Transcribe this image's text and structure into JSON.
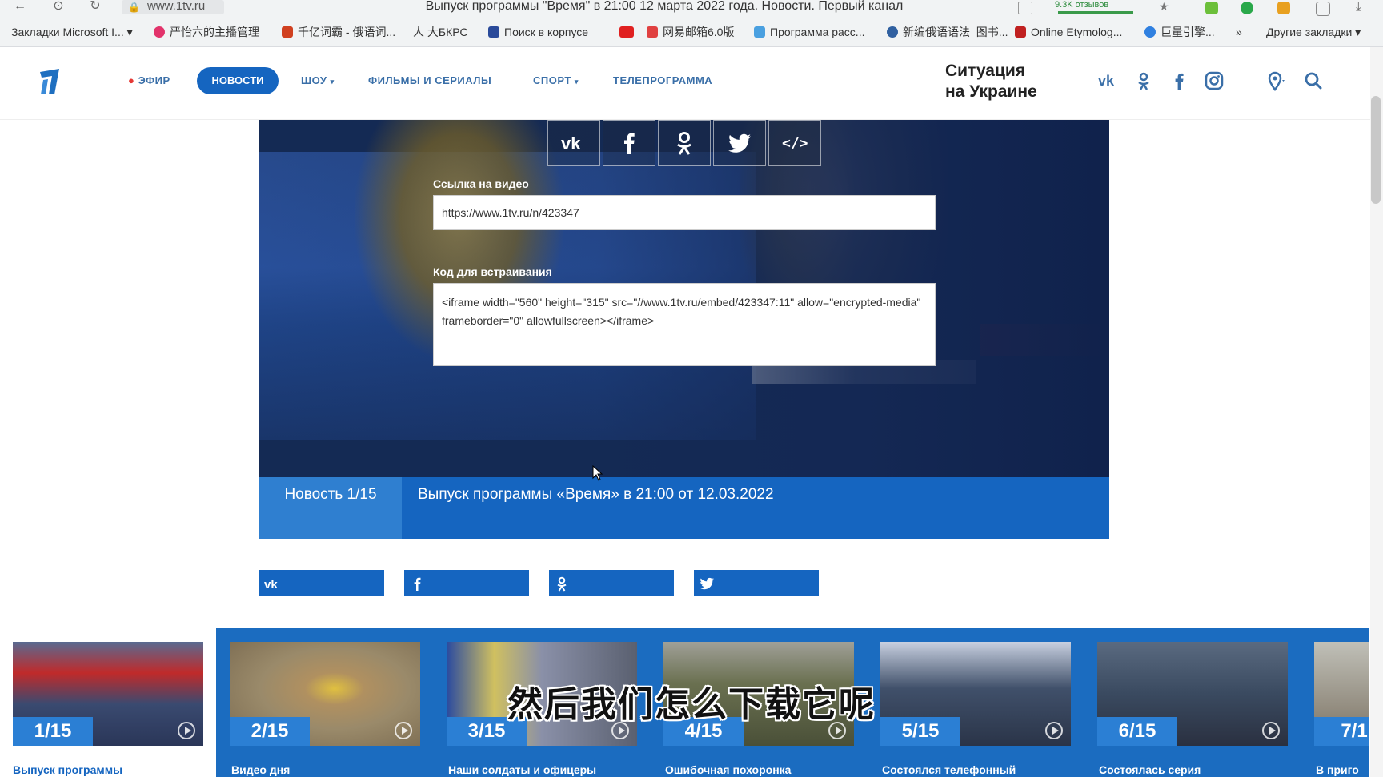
{
  "browser": {
    "url": "www.1tv.ru",
    "title": "Выпуск программы \"Время\" в 21:00 12 марта 2022 года. Новости. Первый канал",
    "review_badge": "9.3K отзывов",
    "bookmarks": [
      {
        "label": "Закладки Microsoft I...",
        "color": "#3a7bd5"
      },
      {
        "label": "严怡六的主播管理",
        "color": "#e2336b"
      },
      {
        "label": "千亿词霸 - 俄语词...",
        "color": "#d04020"
      },
      {
        "label": "大БКРС",
        "color": "#555555"
      },
      {
        "label": "Поиск в корпусе",
        "color": "#2a4a9a"
      },
      {
        "label": "",
        "color": "#e02020"
      },
      {
        "label": "网易邮箱6.0版",
        "color": "#e04040"
      },
      {
        "label": "Программа расс...",
        "color": "#4aa0e0"
      },
      {
        "label": "新编俄语语法_图书...",
        "color": "#3060a0"
      },
      {
        "label": "Online Etymolog...",
        "color": "#c02020"
      },
      {
        "label": "巨量引擎...",
        "color": "#3080e0"
      }
    ],
    "more_bookmarks": "»",
    "other_bookmarks": "Другие закладки"
  },
  "header": {
    "nav": [
      {
        "label": "ЭФИР",
        "id": "live"
      },
      {
        "label": "НОВОСТИ",
        "id": "news"
      },
      {
        "label": "ШОУ",
        "id": "show"
      },
      {
        "label": "ФИЛЬМЫ И СЕРИАЛЫ",
        "id": "films"
      },
      {
        "label": "СПОРТ",
        "id": "sport"
      },
      {
        "label": "ТЕЛЕПРОГРАММА",
        "id": "tvguide"
      }
    ],
    "promo_line1": "Ситуация",
    "promo_line2": "на Украине",
    "live_dot_color": "#e53935",
    "accent": "#1565c0"
  },
  "share_panel": {
    "buttons": [
      "vk-icon",
      "facebook-icon",
      "odnoklassniki-icon",
      "twitter-icon",
      "embed-code-icon"
    ],
    "link_label": "Ссылка на видео",
    "link_value": "https://www.1tv.ru/n/423347",
    "embed_label": "Код для встраивания",
    "embed_value": "<iframe width=\"560\" height=\"315\" src=\"//www.1tv.ru/embed/423347:11\" allow=\"encrypted-media\" frameborder=\"0\" allowfullscreen></iframe>"
  },
  "caption": {
    "counter": "Новость 1/15",
    "title": "Выпуск программы «Время» в 21:00 от 12.03.2022"
  },
  "social_bar": [
    "vk-icon",
    "facebook-icon",
    "odnoklassniki-icon",
    "twitter-icon"
  ],
  "carousel": [
    {
      "num": "1/15",
      "title": "Выпуск программы",
      "thumb": "#4a5a80"
    },
    {
      "num": "2/15",
      "title": "Видео дня",
      "thumb": "#9a8a6a"
    },
    {
      "num": "3/15",
      "title": "Наши солдаты и офицеры",
      "thumb": "#6a7090"
    },
    {
      "num": "4/15",
      "title": "Ошибочная похоронка",
      "thumb": "#6a7050"
    },
    {
      "num": "5/15",
      "title": "Состоялся телефонный",
      "thumb": "#40506a"
    },
    {
      "num": "6/15",
      "title": "Состоялась серия",
      "thumb": "#3a4a60"
    },
    {
      "num": "7/1",
      "title": "В приго",
      "thumb": "#7a7060"
    }
  ],
  "subtitle": "然后我们怎么下载它呢"
}
